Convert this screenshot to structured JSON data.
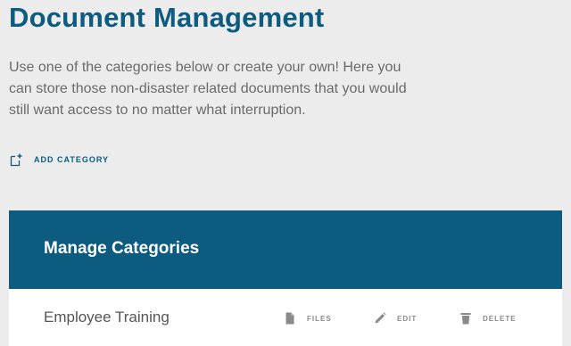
{
  "page": {
    "title": "Document Management",
    "intro": "Use one of the categories below or create your own! Here you can store those non-disaster related documents that you would still want access to no matter what interruption."
  },
  "add_category": {
    "label": "ADD CATEGORY",
    "icon": "add-document-icon"
  },
  "panel": {
    "title": "Manage Categories",
    "categories": [
      {
        "name": "Employee Training",
        "actions": {
          "files": "FILES",
          "edit": "EDIT",
          "delete": "DELETE"
        }
      }
    ]
  },
  "colors": {
    "background": "#ececec",
    "accent": "#0d5c80",
    "body_text": "#6a6a6a",
    "action_text": "#8a8a8a",
    "row_background": "#ffffff"
  }
}
